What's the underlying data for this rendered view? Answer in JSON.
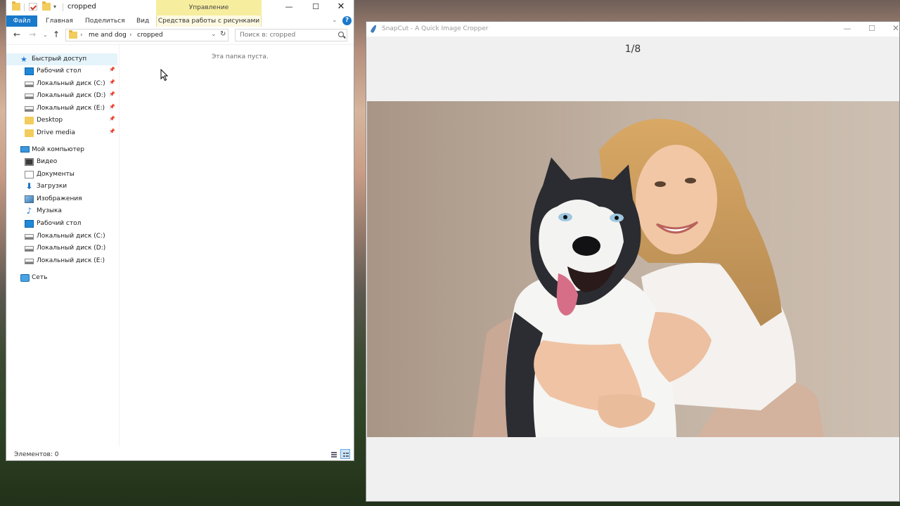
{
  "explorer": {
    "window_title": "cropped",
    "manage_tab": "Управление",
    "ribbon": {
      "file": "Файл",
      "home": "Главная",
      "share": "Поделиться",
      "view": "Вид",
      "picture_tools": "Средства работы с рисунками"
    },
    "address": {
      "crumbs": [
        "me and dog",
        "cropped"
      ]
    },
    "search": {
      "placeholder": "Поиск в: cropped"
    },
    "nav": {
      "quick_access": "Быстрый доступ",
      "quick_items": [
        {
          "label": "Рабочий стол",
          "icon": "desktop-icon"
        },
        {
          "label": "Локальный диск (C:)",
          "icon": "disk-icon"
        },
        {
          "label": "Локальный диск (D:)",
          "icon": "disk-icon"
        },
        {
          "label": "Локальный диск (E:)",
          "icon": "disk-icon"
        },
        {
          "label": "Desktop",
          "icon": "folder-icon"
        },
        {
          "label": "Drive media",
          "icon": "folder-icon"
        }
      ],
      "my_computer": "Мой компьютер",
      "computer_items": [
        {
          "label": "Видео",
          "icon": "video-icon"
        },
        {
          "label": "Документы",
          "icon": "documents-icon"
        },
        {
          "label": "Загрузки",
          "icon": "downloads-icon"
        },
        {
          "label": "Изображения",
          "icon": "pictures-icon"
        },
        {
          "label": "Музыка",
          "icon": "music-icon"
        },
        {
          "label": "Рабочий стол",
          "icon": "desktop-icon"
        },
        {
          "label": "Локальный диск (C:)",
          "icon": "disk-icon"
        },
        {
          "label": "Локальный диск (D:)",
          "icon": "disk-icon"
        },
        {
          "label": "Локальный диск (E:)",
          "icon": "disk-icon"
        }
      ],
      "network": "Сеть"
    },
    "empty_message": "Эта папка пуста.",
    "status": "Элементов: 0"
  },
  "snapcut": {
    "window_title": "SnapCut - A Quick Image Cropper",
    "counter": "1/8"
  },
  "colors": {
    "accent": "#1979ca",
    "manage_tab": "#f7ed9e",
    "selection": "#e5f3fb"
  }
}
